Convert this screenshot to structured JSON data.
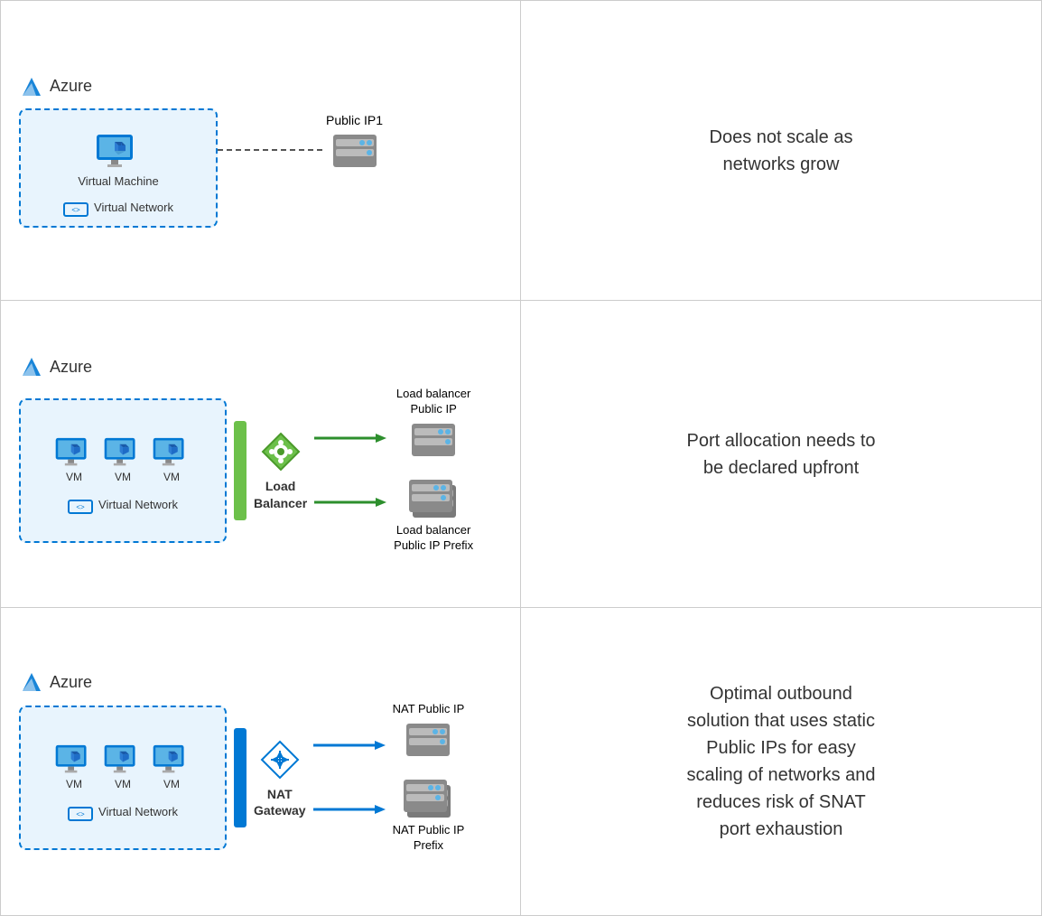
{
  "rows": [
    {
      "id": "row1",
      "description": "Does not scale as\nnetworks grow"
    },
    {
      "id": "row2",
      "description": "Port allocation needs to\nbe declared upfront"
    },
    {
      "id": "row3",
      "description": "Optimal outbound\nsolution that uses static\nPublic IPs for easy\nscaling of networks and\nreduces risk of SNAT\nport exhaustion"
    }
  ],
  "diagram1": {
    "azure_label": "Azure",
    "vm_label": "Virtual Machine",
    "vnet_label": "Virtual Network",
    "public_ip_label": "Public IP1"
  },
  "diagram2": {
    "azure_label": "Azure",
    "vm_labels": [
      "VM",
      "VM",
      "VM"
    ],
    "vnet_label": "Virtual Network",
    "lb_label": "Load\nBalancer",
    "target1_label": "Load balancer\nPublic IP",
    "target2_label": "Load balancer\nPublic IP Prefix"
  },
  "diagram3": {
    "azure_label": "Azure",
    "vm_labels": [
      "VM",
      "VM",
      "VM"
    ],
    "vnet_label": "Virtual Network",
    "nat_label": "NAT\nGateway",
    "target1_label": "NAT Public IP",
    "target2_label": "NAT Public IP\nPrefix"
  }
}
